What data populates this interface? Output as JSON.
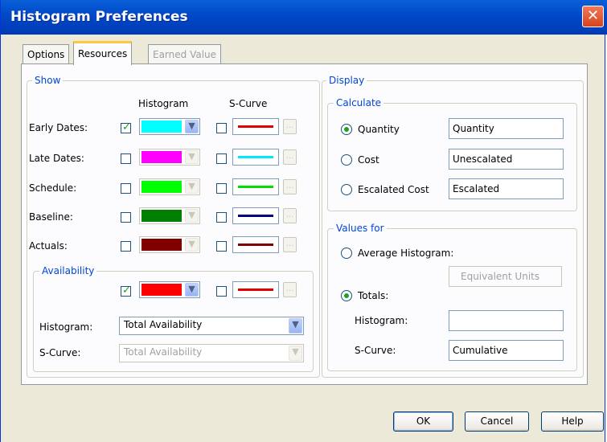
{
  "window": {
    "title": "Histogram Preferences",
    "close_glyph": "✕"
  },
  "tabs": [
    {
      "label": "Options",
      "state": "normal"
    },
    {
      "label": "Resources",
      "state": "active"
    },
    {
      "label": "Earned Value",
      "state": "disabled"
    }
  ],
  "show": {
    "legend": "Show",
    "histogram_header": "Histogram",
    "scurve_header": "S-Curve",
    "rows": [
      {
        "label": "Early Dates:",
        "hist_checked": true,
        "hist_color": "#00ffff",
        "hist_enabled": true,
        "scurve_checked": false,
        "scurve_color": "#e00000"
      },
      {
        "label": "Late Dates:",
        "hist_checked": false,
        "hist_color": "#ff00ff",
        "hist_enabled": false,
        "scurve_checked": false,
        "scurve_color": "#00e8ff"
      },
      {
        "label": "Schedule:",
        "hist_checked": false,
        "hist_color": "#00ff00",
        "hist_enabled": false,
        "scurve_checked": false,
        "scurve_color": "#00e000"
      },
      {
        "label": "Baseline:",
        "hist_checked": false,
        "hist_color": "#007f00",
        "hist_enabled": false,
        "scurve_checked": false,
        "scurve_color": "#000080"
      },
      {
        "label": "Actuals:",
        "hist_checked": false,
        "hist_color": "#800000",
        "hist_enabled": false,
        "scurve_checked": false,
        "scurve_color": "#800000"
      }
    ]
  },
  "availability": {
    "legend": "Availability",
    "hist_checked": true,
    "hist_color": "#ff0000",
    "scurve_checked": false,
    "scurve_color": "#e00000",
    "histogram_label": "Histogram:",
    "histogram_value": "Total Availability",
    "scurve_label": "S-Curve:",
    "scurve_value": "Total Availability"
  },
  "display": {
    "legend": "Display",
    "calculate": {
      "legend": "Calculate",
      "options": [
        {
          "label": "Quantity",
          "selected": true,
          "value": "Quantity"
        },
        {
          "label": "Cost",
          "selected": false,
          "value": "Unescalated"
        },
        {
          "label": "Escalated Cost",
          "selected": false,
          "value": "Escalated"
        }
      ]
    },
    "values_for": {
      "legend": "Values for",
      "average_label": "Average Histogram:",
      "average_selected": false,
      "average_value": "Equivalent Units",
      "totals_label": "Totals:",
      "totals_selected": true,
      "histogram_label": "Histogram:",
      "histogram_value": "",
      "scurve_label": "S-Curve:",
      "scurve_value": "Cumulative"
    }
  },
  "buttons": {
    "ok": "OK",
    "cancel": "Cancel",
    "help": "Help"
  },
  "icons": {
    "dropdown": "chevron-down-icon",
    "check": "check-icon"
  }
}
